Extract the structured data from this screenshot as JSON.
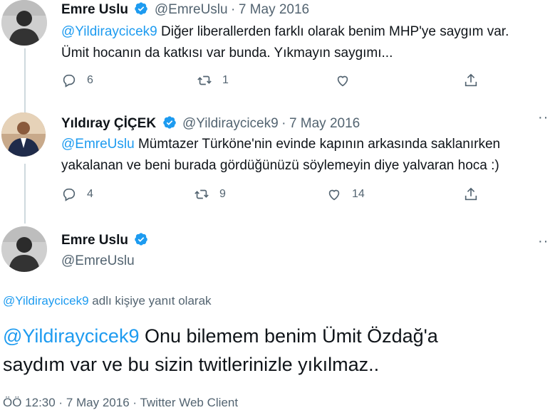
{
  "tweet1": {
    "name": "Emre Uslu",
    "handle": "@EmreUslu",
    "sep": "·",
    "date": "7 May 2016",
    "mention": "@Yildiraycicek9",
    "text_after_mention": " Diğer liberallerden farklı olarak benim MHP'ye saygım var.",
    "text_line2": "Ümit hocanın da katkısı var bunda. Yıkmayın saygımı...",
    "replies": "6",
    "retweets": "1"
  },
  "tweet2": {
    "name": "Yıldıray ÇİÇEK",
    "handle": "@Yildiraycicek9",
    "sep": "·",
    "date": "7 May 2016",
    "mention": "@EmreUslu",
    "text_after_mention": " Mümtazer Türköne'nin evinde kapının arkasında saklanırken",
    "text_line2": "yakalanan ve beni burada gördüğünüzü söylemeyin diye yalvaran hoca :)",
    "replies": "4",
    "retweets": "9",
    "likes": "14"
  },
  "main_tweet": {
    "name": "Emre Uslu",
    "handle": "@EmreUslu",
    "reply_mention": "@Yildiraycicek9",
    "reply_suffix": " adlı kişiye yanıt olarak",
    "mention": "@Yildiraycicek9",
    "text_after_mention": " Onu bilemem benim Ümit Özdağ'a",
    "text_line2": "saydım var ve bu sizin twitlerinizle yıkılmaz..",
    "footer": "ÖÖ 12:30 · 7 May 2016 · Twitter Web Client"
  },
  "colors": {
    "accent": "#1d9bf0",
    "muted": "#536471",
    "thread_line": "#cfd9de"
  },
  "icons": [
    "verified-badge-icon",
    "reply-icon",
    "retweet-icon",
    "like-icon",
    "share-icon",
    "more-icon"
  ]
}
